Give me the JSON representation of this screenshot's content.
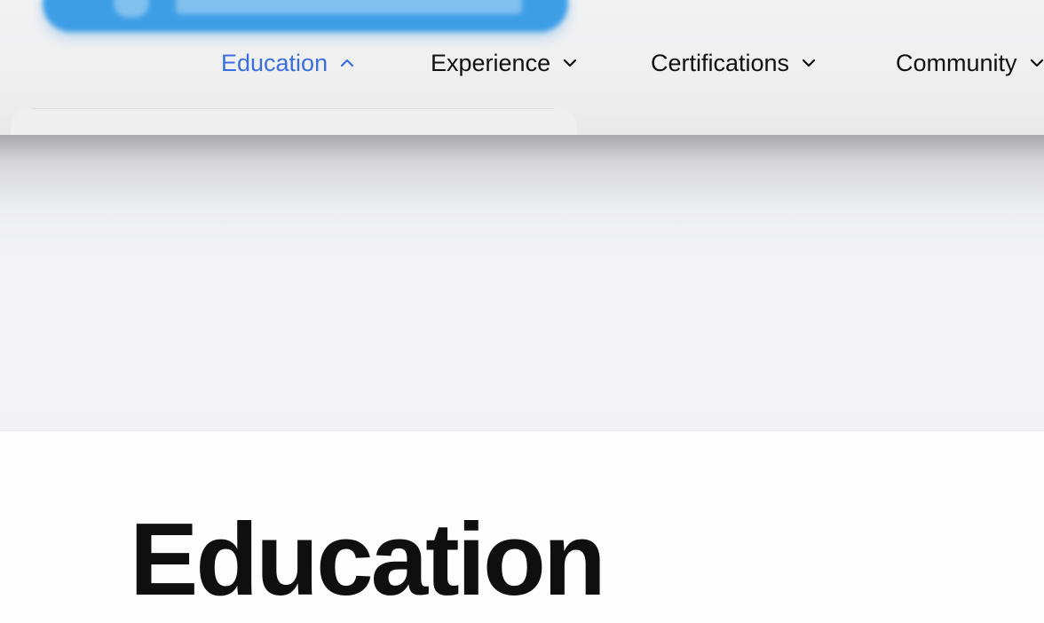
{
  "nav": {
    "items": [
      {
        "label": "Education",
        "state": "expanded",
        "active": true,
        "chevron": "chevron-up-icon"
      },
      {
        "label": "Experience",
        "state": "collapsed",
        "active": false,
        "chevron": "chevron-down-icon"
      },
      {
        "label": "Certifications",
        "state": "collapsed",
        "active": false,
        "chevron": "chevron-down-icon"
      },
      {
        "label": "Community",
        "state": "collapsed",
        "active": false,
        "chevron": "chevron-down-icon"
      }
    ]
  },
  "main": {
    "title": "Education"
  },
  "colors": {
    "accent": "#3b6fe0",
    "cta": "#3d9ee6",
    "text": "#111111",
    "band": "#f4f4f6"
  }
}
